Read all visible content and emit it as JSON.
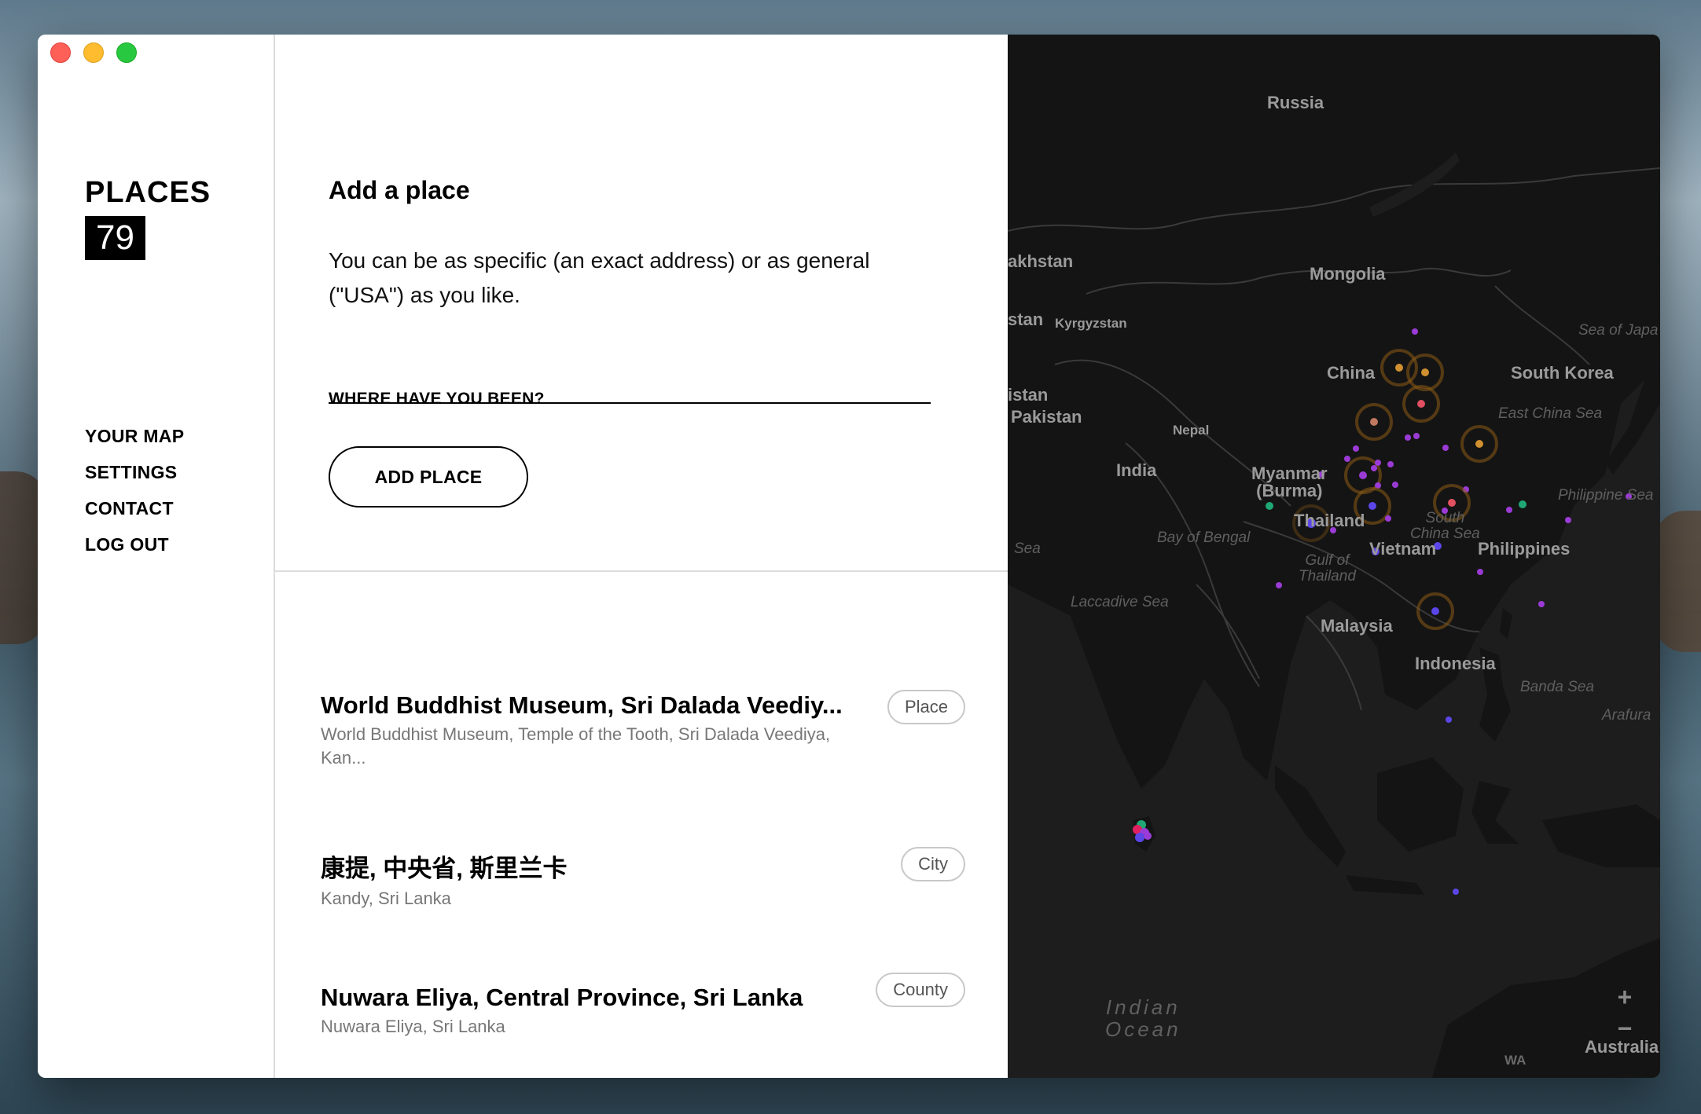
{
  "app": {
    "brand_title": "PLACES",
    "place_count": "79"
  },
  "nav": {
    "items": [
      "YOUR MAP",
      "SETTINGS",
      "CONTACT",
      "LOG OUT"
    ]
  },
  "add_place": {
    "title": "Add a place",
    "description": "You can be as specific (an exact address) or as general (\"USA\") as you like.",
    "input_value": "",
    "input_label": "WHERE HAVE YOU BEEN?",
    "button_label": "ADD PLACE"
  },
  "places": [
    {
      "title": "World Buddhist Museum, Sri Dalada Veediy...",
      "subtitle": "World Buddhist Museum, Temple of the Tooth, Sri Dalada Veediya, Kan...",
      "type": "Place"
    },
    {
      "title": "康提, 中央省, 斯里兰卡",
      "subtitle": "Kandy, Sri Lanka",
      "type": "City"
    },
    {
      "title": "Nuwara Eliya, Central Province, Sri Lanka",
      "subtitle": "Nuwara Eliya, Sri Lanka",
      "type": "County"
    }
  ],
  "map": {
    "labels": {
      "russia": "Russia",
      "kazakhstan": "akhstan",
      "mongolia": "Mongolia",
      "kyrgyzstan": "Kyrgyzstan",
      "stan": "stan",
      "china": "China",
      "south_korea": "South Korea",
      "sea_of_japan": "Sea of Japa",
      "east_china_sea": "East China Sea",
      "istan": "istan",
      "pakistan": "Pakistan",
      "nepal": "Nepal",
      "india": "India",
      "myanmar": "Myanmar\n(Burma)",
      "philippine_sea": "Philippine Sea",
      "thailand": "Thailand",
      "south_china_sea": "South\nChina Sea",
      "bay_of_bengal": "Bay of Bengal",
      "sea_left": "Sea",
      "vietnam": "Vietnam",
      "philippines": "Philippines",
      "gulf_of_thailand": "Gulf of\nThailand",
      "laccadive_sea": "Laccadive Sea",
      "malaysia": "Malaysia",
      "indonesia": "Indonesia",
      "banda_sea": "Banda Sea",
      "arafura": "Arafura",
      "indian_ocean": "Indian\nOcean",
      "wa": "WA",
      "australia": "Australia"
    },
    "zoom_in": "+",
    "zoom_out": "−",
    "colors": {
      "background": "#1d1d1d",
      "land": "#141414",
      "border": "#3a3a3a",
      "marker_purple": "#9b3bd6",
      "marker_blue": "#5b46e8",
      "marker_green": "#1fa774",
      "marker_ring": "#8a5a14"
    }
  }
}
